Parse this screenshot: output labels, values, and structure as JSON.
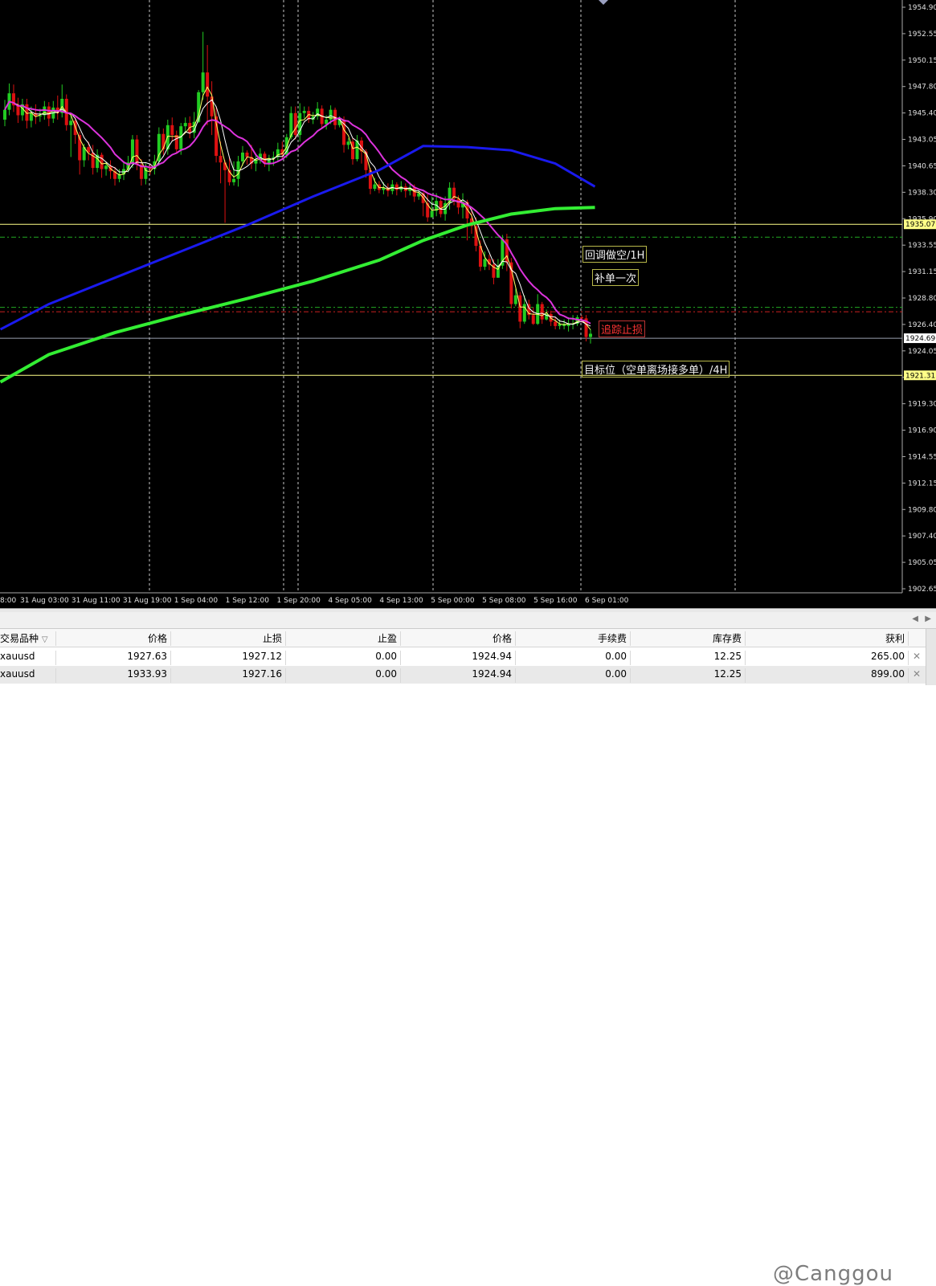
{
  "colors": {
    "background": "#000000",
    "grid": "#c8c8c8",
    "bull_candle": "#22cc22",
    "bear_candle": "#dd1111",
    "ma_blue": "#1a1aee",
    "ma_green": "#33ee33",
    "ma_magenta": "#dd33dd",
    "ma_white": "#ffffff",
    "ma_yellow": "#ffff66",
    "level_yellow": "#ffff88",
    "level_green_dash": "#22aa22",
    "level_red_dash": "#cc2222"
  },
  "price_axis": {
    "labels": [
      "1954.90",
      "1952.55",
      "1950.15",
      "1947.80",
      "1945.40",
      "1943.05",
      "1940.65",
      "1938.30",
      "1935.90",
      "1933.55",
      "1931.15",
      "1928.80",
      "1926.40",
      "1924.05",
      "1921.65",
      "1919.30",
      "1916.90",
      "1914.55",
      "1912.15",
      "1909.80",
      "1907.40",
      "1905.05",
      "1902.65"
    ],
    "tags": {
      "level_upper": "1935.07",
      "current": "1924.69",
      "level_lower": "1921.31"
    }
  },
  "time_axis": {
    "labels": [
      "8:00",
      "31 Aug 03:00",
      "31 Aug 11:00",
      "31 Aug 19:00",
      "1 Sep 04:00",
      "1 Sep 12:00",
      "1 Sep 20:00",
      "4 Sep 05:00",
      "4 Sep 13:00",
      "5 Sep 00:00",
      "5 Sep 08:00",
      "5 Sep 16:00",
      "6 Sep 01:00"
    ]
  },
  "annotations": {
    "pullback_short": "回调做空/1H",
    "add_once": "补单一次",
    "trailing_stop": "追踪止损",
    "target": "目标位（空单离场接多单）/4H"
  },
  "chart_data": {
    "type": "candlestick",
    "symbol": "xauusd",
    "y_range": [
      1901.5,
      1955.5
    ],
    "levels": [
      {
        "name": "level_upper",
        "value": 1935.07,
        "style": "solid-yellow"
      },
      {
        "name": "level_green_1",
        "value": 1933.9,
        "style": "dash-green"
      },
      {
        "name": "level_green_2",
        "value": 1927.5,
        "style": "dash-green"
      },
      {
        "name": "level_red",
        "value": 1927.1,
        "style": "dash-red"
      },
      {
        "name": "current",
        "value": 1924.69,
        "style": "solid-grey"
      },
      {
        "name": "level_lower",
        "value": 1921.31,
        "style": "solid-yellow"
      }
    ],
    "candles": [
      [
        1944.6,
        1945.5,
        1946.4,
        1944.0
      ],
      [
        1945.5,
        1947.0,
        1947.9,
        1945.0
      ],
      [
        1947.0,
        1945.9,
        1947.8,
        1945.3
      ],
      [
        1945.9,
        1945.0,
        1946.6,
        1944.3
      ],
      [
        1945.0,
        1946.0,
        1946.5,
        1944.5
      ],
      [
        1946.0,
        1944.5,
        1946.5,
        1943.8
      ],
      [
        1944.5,
        1945.2,
        1945.8,
        1943.9
      ],
      [
        1945.2,
        1944.9,
        1946.0,
        1944.2
      ],
      [
        1944.9,
        1945.0,
        1945.6,
        1944.4
      ],
      [
        1945.0,
        1945.8,
        1946.3,
        1944.6
      ],
      [
        1945.8,
        1944.7,
        1946.2,
        1944.0
      ],
      [
        1944.7,
        1945.7,
        1946.3,
        1944.3
      ],
      [
        1945.7,
        1945.2,
        1946.8,
        1944.6
      ],
      [
        1945.2,
        1946.5,
        1947.8,
        1944.8
      ],
      [
        1946.5,
        1944.1,
        1946.9,
        1943.6
      ],
      [
        1944.1,
        1944.5,
        1945.1,
        1941.2
      ],
      [
        1944.5,
        1943.2,
        1944.8,
        1942.4
      ],
      [
        1943.2,
        1940.9,
        1943.5,
        1939.6
      ],
      [
        1940.9,
        1942.1,
        1942.4,
        1940.3
      ],
      [
        1942.1,
        1941.6,
        1942.6,
        1940.9
      ],
      [
        1941.6,
        1940.2,
        1942.3,
        1939.6
      ],
      [
        1940.2,
        1941.4,
        1941.9,
        1939.8
      ],
      [
        1941.4,
        1940.1,
        1941.6,
        1939.3
      ],
      [
        1940.1,
        1940.4,
        1940.7,
        1939.5
      ],
      [
        1940.4,
        1939.9,
        1940.9,
        1939.2
      ],
      [
        1939.9,
        1939.2,
        1940.3,
        1938.6
      ],
      [
        1939.2,
        1939.6,
        1940.1,
        1938.9
      ],
      [
        1939.6,
        1940.1,
        1940.8,
        1939.1
      ],
      [
        1940.1,
        1940.7,
        1941.3,
        1939.8
      ],
      [
        1940.7,
        1942.8,
        1943.2,
        1940.2
      ],
      [
        1942.8,
        1940.5,
        1943.2,
        1940.0
      ],
      [
        1940.5,
        1939.2,
        1941.0,
        1938.6
      ],
      [
        1939.2,
        1940.2,
        1940.6,
        1938.7
      ],
      [
        1940.2,
        1940.1,
        1940.6,
        1939.6
      ],
      [
        1940.1,
        1940.8,
        1941.4,
        1939.6
      ],
      [
        1940.8,
        1943.3,
        1943.9,
        1940.4
      ],
      [
        1943.3,
        1941.9,
        1943.8,
        1941.4
      ],
      [
        1941.9,
        1944.1,
        1944.6,
        1941.4
      ],
      [
        1944.1,
        1943.2,
        1944.8,
        1942.6
      ],
      [
        1943.2,
        1941.9,
        1943.6,
        1941.5
      ],
      [
        1941.9,
        1944.0,
        1944.3,
        1941.4
      ],
      [
        1944.0,
        1944.3,
        1944.8,
        1943.5
      ],
      [
        1944.3,
        1943.4,
        1944.9,
        1942.9
      ],
      [
        1943.4,
        1944.4,
        1945.3,
        1942.9
      ],
      [
        1944.4,
        1947.1,
        1947.3,
        1944.3
      ],
      [
        1947.1,
        1948.9,
        1952.6,
        1946.4
      ],
      [
        1948.9,
        1946.7,
        1951.4,
        1944.1
      ],
      [
        1946.7,
        1944.9,
        1948.1,
        1943.2
      ],
      [
        1944.9,
        1941.3,
        1945.8,
        1940.7
      ],
      [
        1941.3,
        1940.7,
        1942.6,
        1938.8
      ],
      [
        1940.7,
        1940.0,
        1940.9,
        1935.2
      ],
      [
        1940.0,
        1938.9,
        1941.2,
        1938.6
      ],
      [
        1938.9,
        1939.2,
        1940.8,
        1938.6
      ],
      [
        1939.2,
        1940.8,
        1941.3,
        1938.5
      ],
      [
        1940.8,
        1941.6,
        1942.2,
        1940.4
      ],
      [
        1941.6,
        1941.2,
        1941.8,
        1940.5
      ],
      [
        1941.2,
        1940.6,
        1942.3,
        1940.1
      ],
      [
        1940.6,
        1940.9,
        1941.5,
        1939.9
      ],
      [
        1940.9,
        1941.5,
        1942.0,
        1940.6
      ],
      [
        1941.5,
        1940.6,
        1941.7,
        1940.3
      ],
      [
        1940.6,
        1941.1,
        1941.4,
        1939.9
      ],
      [
        1941.1,
        1941.2,
        1941.7,
        1940.4
      ],
      [
        1941.2,
        1941.9,
        1942.5,
        1940.8
      ],
      [
        1941.9,
        1941.4,
        1942.6,
        1941.0
      ],
      [
        1941.4,
        1943.0,
        1943.3,
        1941.1
      ],
      [
        1943.0,
        1945.2,
        1945.8,
        1942.8
      ],
      [
        1945.2,
        1943.2,
        1945.8,
        1942.8
      ],
      [
        1943.2,
        1945.2,
        1946.1,
        1942.6
      ],
      [
        1945.2,
        1945.4,
        1945.8,
        1944.7
      ],
      [
        1945.4,
        1944.6,
        1945.8,
        1944.3
      ],
      [
        1944.6,
        1944.9,
        1945.3,
        1944.2
      ],
      [
        1944.9,
        1945.6,
        1946.2,
        1944.6
      ],
      [
        1945.6,
        1944.2,
        1945.9,
        1943.8
      ],
      [
        1944.2,
        1944.6,
        1945.0,
        1943.7
      ],
      [
        1944.6,
        1945.5,
        1945.9,
        1944.2
      ],
      [
        1945.5,
        1944.1,
        1945.7,
        1943.7
      ],
      [
        1944.1,
        1944.6,
        1944.9,
        1943.9
      ],
      [
        1944.6,
        1942.3,
        1944.9,
        1941.6
      ],
      [
        1942.3,
        1942.6,
        1942.9,
        1941.9
      ],
      [
        1942.6,
        1941.0,
        1942.9,
        1940.5
      ],
      [
        1941.0,
        1942.7,
        1943.2,
        1940.8
      ],
      [
        1942.7,
        1941.7,
        1943.0,
        1940.6
      ],
      [
        1941.7,
        1940.0,
        1941.9,
        1939.3
      ],
      [
        1940.0,
        1938.3,
        1940.2,
        1937.8
      ],
      [
        1938.3,
        1938.7,
        1939.3,
        1938.1
      ],
      [
        1938.7,
        1938.2,
        1939.0,
        1937.9
      ],
      [
        1938.2,
        1938.4,
        1938.9,
        1937.8
      ],
      [
        1938.4,
        1938.1,
        1938.8,
        1937.6
      ],
      [
        1938.1,
        1938.7,
        1939.1,
        1937.8
      ],
      [
        1938.7,
        1938.2,
        1938.9,
        1937.7
      ],
      [
        1938.2,
        1938.5,
        1939.0,
        1938.0
      ],
      [
        1938.5,
        1938.1,
        1938.8,
        1937.5
      ],
      [
        1938.1,
        1938.4,
        1938.9,
        1937.7
      ],
      [
        1938.4,
        1937.6,
        1938.7,
        1937.1
      ],
      [
        1937.6,
        1937.9,
        1938.2,
        1937.3
      ],
      [
        1937.9,
        1937.0,
        1938.0,
        1935.8
      ],
      [
        1937.0,
        1935.7,
        1937.8,
        1935.3
      ],
      [
        1935.7,
        1936.3,
        1937.6,
        1935.7
      ],
      [
        1936.3,
        1937.2,
        1937.9,
        1935.8
      ],
      [
        1937.2,
        1936.0,
        1937.6,
        1935.7
      ],
      [
        1936.0,
        1937.0,
        1937.6,
        1935.4
      ],
      [
        1937.0,
        1938.4,
        1938.9,
        1936.4
      ],
      [
        1938.4,
        1937.4,
        1938.9,
        1936.8
      ],
      [
        1937.4,
        1936.6,
        1937.7,
        1936.0
      ],
      [
        1936.6,
        1937.1,
        1937.9,
        1935.6
      ],
      [
        1937.1,
        1935.6,
        1937.3,
        1933.6
      ],
      [
        1935.6,
        1934.9,
        1936.6,
        1934.2
      ],
      [
        1934.9,
        1933.1,
        1935.7,
        1932.6
      ],
      [
        1933.1,
        1931.2,
        1933.6,
        1930.8
      ],
      [
        1931.2,
        1931.9,
        1932.6,
        1930.9
      ],
      [
        1931.9,
        1931.4,
        1932.3,
        1930.9
      ],
      [
        1931.4,
        1930.2,
        1931.9,
        1929.6
      ],
      [
        1930.2,
        1931.3,
        1931.9,
        1930.2
      ],
      [
        1931.3,
        1933.7,
        1934.1,
        1931.0
      ],
      [
        1933.7,
        1931.6,
        1934.2,
        1930.8
      ],
      [
        1931.6,
        1927.8,
        1932.0,
        1927.4
      ],
      [
        1927.8,
        1928.6,
        1929.2,
        1927.6
      ],
      [
        1928.6,
        1926.2,
        1928.9,
        1925.6
      ],
      [
        1926.2,
        1927.8,
        1928.6,
        1926.0
      ],
      [
        1927.8,
        1926.8,
        1928.2,
        1926.4
      ],
      [
        1926.8,
        1926.0,
        1927.5,
        1925.9
      ],
      [
        1926.0,
        1927.8,
        1928.7,
        1925.9
      ],
      [
        1927.8,
        1926.4,
        1928.0,
        1926.0
      ],
      [
        1926.4,
        1926.9,
        1927.3,
        1926.3
      ],
      [
        1926.9,
        1926.2,
        1927.2,
        1925.8
      ],
      [
        1926.2,
        1925.8,
        1926.6,
        1925.5
      ],
      [
        1925.8,
        1926.0,
        1926.4,
        1925.5
      ],
      [
        1925.8,
        1926.0,
        1926.4,
        1925.5
      ],
      [
        1925.8,
        1926.0,
        1926.6,
        1925.3
      ],
      [
        1926.0,
        1926.0,
        1926.8,
        1925.5
      ],
      [
        1926.0,
        1926.6,
        1926.8,
        1925.8
      ],
      [
        1926.6,
        1926.5,
        1926.8,
        1926.1
      ],
      [
        1926.5,
        1924.8,
        1926.8,
        1924.4
      ],
      [
        1924.8,
        1925.1,
        1925.5,
        1924.2
      ]
    ]
  },
  "orders": {
    "headers": [
      "交易品种",
      "价格",
      "止损",
      "止盈",
      "价格",
      "手续费",
      "库存费",
      "获利"
    ],
    "sort_indicator": "▽",
    "rows": [
      {
        "symbol": "xauusd",
        "open_price": "1927.63",
        "stop_loss": "1927.12",
        "take_profit": "0.00",
        "price": "1924.94",
        "commission": "0.00",
        "swap": "12.25",
        "profit": "265.00"
      },
      {
        "symbol": "xauusd",
        "open_price": "1933.93",
        "stop_loss": "1927.16",
        "take_profit": "0.00",
        "price": "1924.94",
        "commission": "0.00",
        "swap": "12.25",
        "profit": "899.00"
      }
    ]
  },
  "watermark": "@Canggou"
}
